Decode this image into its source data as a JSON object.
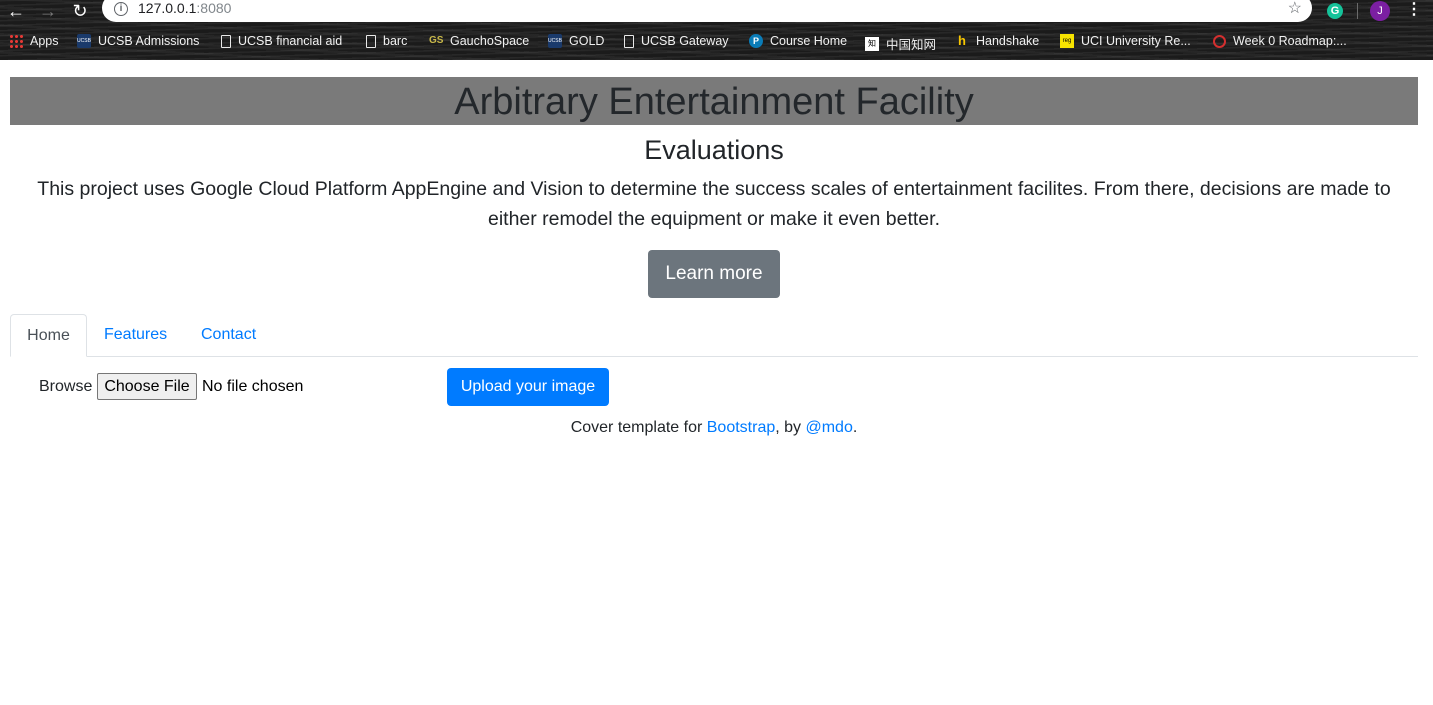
{
  "browser": {
    "url_host": "127.0.0.1",
    "url_port": ":8080",
    "avatar_letter": "J",
    "extension_letter": "G",
    "bookmarks": [
      {
        "label": "Apps",
        "icon": "apps-grid-icon"
      },
      {
        "label": "UCSB Admissions",
        "icon": "ucsb-icon",
        "icon_text": "UCSB"
      },
      {
        "label": "UCSB financial aid",
        "icon": "document-icon"
      },
      {
        "label": "barc",
        "icon": "document-icon"
      },
      {
        "label": "GauchoSpace",
        "icon": "gauchospace-icon",
        "icon_text": "GS"
      },
      {
        "label": "GOLD",
        "icon": "ucsb-icon",
        "icon_text": "UCSB"
      },
      {
        "label": "UCSB Gateway",
        "icon": "document-icon"
      },
      {
        "label": "Course Home",
        "icon": "pearson-icon",
        "icon_text": "P"
      },
      {
        "label": "中国知网",
        "icon": "cnki-icon",
        "icon_text": "知"
      },
      {
        "label": "Handshake",
        "icon": "handshake-icon",
        "icon_text": "h"
      },
      {
        "label": "UCI University Re...",
        "icon": "reg-icon",
        "icon_text": "reg"
      },
      {
        "label": "Week 0 Roadmap:...",
        "icon": "red-circle-icon"
      }
    ]
  },
  "header": {
    "title": "Arbitrary Entertainment Facility",
    "subtitle": "Evaluations",
    "description": "This project uses Google Cloud Platform AppEngine and Vision to determine the success scales of entertainment facilites. From there, decisions are made to either remodel the equipment or make it even better.",
    "learn_more_label": "Learn more"
  },
  "tabs": [
    {
      "label": "Home",
      "active": true
    },
    {
      "label": "Features",
      "active": false
    },
    {
      "label": "Contact",
      "active": false
    }
  ],
  "upload": {
    "browse_label": "Browse",
    "choose_file_label": "Choose File",
    "file_status": "No file chosen",
    "upload_label": "Upload your image"
  },
  "footer": {
    "prefix": "Cover template for ",
    "link1": "Bootstrap",
    "middle": ", by ",
    "link2": "@mdo",
    "suffix": "."
  },
  "colors": {
    "primary": "#007bff",
    "secondary": "#6c757d",
    "title_bar": "#7a7a7a"
  }
}
